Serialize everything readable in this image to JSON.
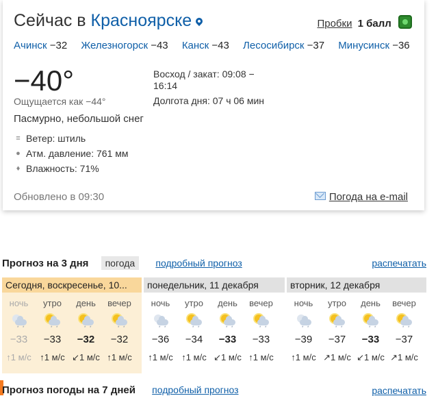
{
  "header": {
    "title_prefix": "Сейчас в",
    "city": "Красноярске",
    "traffic_link": "Пробки",
    "traffic_level": "1 балл"
  },
  "nearby": [
    {
      "name": "Ачинск",
      "temp": "−32"
    },
    {
      "name": "Железногорск",
      "temp": "−43"
    },
    {
      "name": "Канск",
      "temp": "−43"
    },
    {
      "name": "Лесосибирск",
      "temp": "−37"
    },
    {
      "name": "Минусинск",
      "temp": "−36"
    }
  ],
  "current": {
    "temp": "−40°",
    "feels": "Ощущается как −44°",
    "condition": "Пасмурно, небольшой снег",
    "wind": "Ветер: штиль",
    "pressure": "Атм. давление: 761 мм",
    "humidity": "Влажность: 71%",
    "sunrise_sunset": "Восход / закат: 09:08 − 16:14",
    "day_length": "Долгота дня: 07 ч 06 мин",
    "updated": "Обновлено в 09:30",
    "email_link": "Погода на e-mail"
  },
  "forecast3": {
    "title": "Прогноз на 3 дня",
    "tag": "погода",
    "detail_link": "подробный прогноз",
    "print_link": "распечатать",
    "days": [
      {
        "label": "Сегодня, воскресенье, 10...",
        "slots": [
          {
            "part": "ночь",
            "temp": "−33",
            "wind_arrow": "↑",
            "wind": "1 м/с",
            "bold": false,
            "faded": true,
            "night": true
          },
          {
            "part": "утро",
            "temp": "−33",
            "wind_arrow": "↑",
            "wind": "1 м/с",
            "bold": false,
            "faded": false,
            "night": false
          },
          {
            "part": "день",
            "temp": "−32",
            "wind_arrow": "↙",
            "wind": "1 м/с",
            "bold": true,
            "faded": false,
            "night": false
          },
          {
            "part": "вечер",
            "temp": "−32",
            "wind_arrow": "↑",
            "wind": "1 м/с",
            "bold": false,
            "faded": false,
            "night": false
          }
        ]
      },
      {
        "label": "понедельник, 11 декабря",
        "slots": [
          {
            "part": "ночь",
            "temp": "−36",
            "wind_arrow": "↑",
            "wind": "1 м/с",
            "bold": false,
            "faded": false,
            "night": true
          },
          {
            "part": "утро",
            "temp": "−34",
            "wind_arrow": "↑",
            "wind": "1 м/с",
            "bold": false,
            "faded": false,
            "night": false
          },
          {
            "part": "день",
            "temp": "−33",
            "wind_arrow": "↙",
            "wind": "1 м/с",
            "bold": true,
            "faded": false,
            "night": false
          },
          {
            "part": "вечер",
            "temp": "−33",
            "wind_arrow": "↑",
            "wind": "1 м/с",
            "bold": false,
            "faded": false,
            "night": false
          }
        ]
      },
      {
        "label": "вторник, 12 декабря",
        "slots": [
          {
            "part": "ночь",
            "temp": "−39",
            "wind_arrow": "↑",
            "wind": "1 м/с",
            "bold": false,
            "faded": false,
            "night": true
          },
          {
            "part": "утро",
            "temp": "−37",
            "wind_arrow": "↗",
            "wind": "1 м/с",
            "bold": false,
            "faded": false,
            "night": false
          },
          {
            "part": "день",
            "temp": "−33",
            "wind_arrow": "↙",
            "wind": "1 м/с",
            "bold": true,
            "faded": false,
            "night": false
          },
          {
            "part": "вечер",
            "temp": "−37",
            "wind_arrow": "↗",
            "wind": "1 м/с",
            "bold": false,
            "faded": false,
            "night": false
          }
        ]
      }
    ]
  },
  "forecast7": {
    "title": "Прогноз погоды на 7 дней",
    "detail_link": "подробный прогноз",
    "print_link": "распечатать"
  }
}
